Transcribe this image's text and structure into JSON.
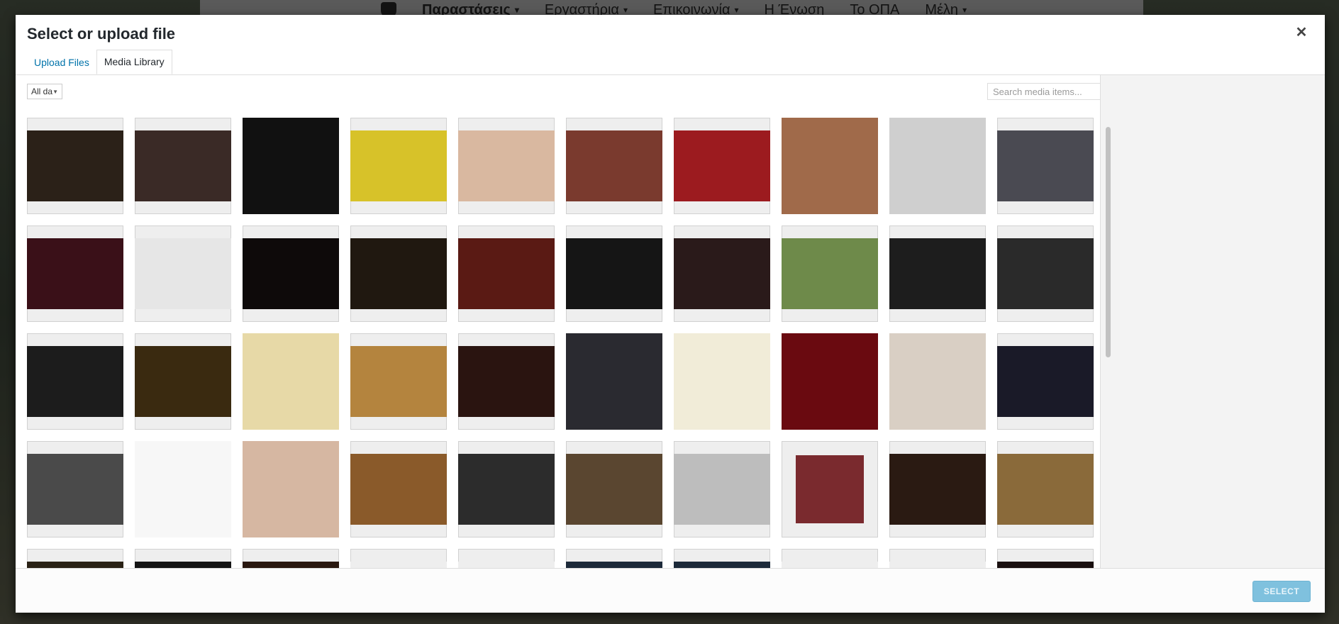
{
  "background_nav": {
    "items": [
      {
        "label": "Παραστάσεις",
        "caret": "▾"
      },
      {
        "label": "Εργαστήρια",
        "caret": "▾"
      },
      {
        "label": "Επικοινωνία",
        "caret": "▾"
      },
      {
        "label": "Η Ένωση",
        "caret": ""
      },
      {
        "label": "Το ΟΠΑ",
        "caret": ""
      },
      {
        "label": "Μέλη",
        "caret": "▾"
      }
    ]
  },
  "modal": {
    "title": "Select or upload file",
    "close_icon": "close-icon",
    "tabs": [
      {
        "label": "Upload Files",
        "active": false
      },
      {
        "label": "Media Library",
        "active": true
      }
    ],
    "filter": {
      "selected": "All da"
    },
    "search": {
      "placeholder": "Search media items..."
    },
    "select_button": "SELECT"
  },
  "media_items": [
    {
      "color": "#2b2118",
      "shape": "wide"
    },
    {
      "color": "#3a2a26",
      "shape": "wide"
    },
    {
      "color": "#111111",
      "shape": "tall"
    },
    {
      "color": "#d7c229",
      "shape": "wide"
    },
    {
      "color": "#d9b8a0",
      "shape": "wide"
    },
    {
      "color": "#7a3a2e",
      "shape": "wide"
    },
    {
      "color": "#9c1b1f",
      "shape": "wide"
    },
    {
      "color": "#a06a4a",
      "shape": "tall"
    },
    {
      "color": "#cfcfcf",
      "shape": "tall"
    },
    {
      "color": "#4a4a52",
      "shape": "wide"
    },
    {
      "color": "#3a1018",
      "shape": "wide"
    },
    {
      "color": "#e6e6e6",
      "shape": "wide"
    },
    {
      "color": "#0e0a0a",
      "shape": "wide"
    },
    {
      "color": "#201810",
      "shape": "wide"
    },
    {
      "color": "#5a1a14",
      "shape": "wide"
    },
    {
      "color": "#151515",
      "shape": "wide"
    },
    {
      "color": "#2a1a1a",
      "shape": "wide"
    },
    {
      "color": "#6e8a4a",
      "shape": "wide"
    },
    {
      "color": "#1d1d1d",
      "shape": "wide"
    },
    {
      "color": "#2a2a2a",
      "shape": "wide"
    },
    {
      "color": "#1c1c1c",
      "shape": "wide"
    },
    {
      "color": "#3a2a10",
      "shape": "wide"
    },
    {
      "color": "#e7d9a7",
      "shape": "tall"
    },
    {
      "color": "#b4843e",
      "shape": "wide"
    },
    {
      "color": "#2a1410",
      "shape": "wide"
    },
    {
      "color": "#2a2a30",
      "shape": "tall"
    },
    {
      "color": "#f1ecd8",
      "shape": "tall"
    },
    {
      "color": "#6a0a10",
      "shape": "tall"
    },
    {
      "color": "#d9cfc4",
      "shape": "tall"
    },
    {
      "color": "#1a1a28",
      "shape": "wide"
    },
    {
      "color": "#4a4a4a",
      "shape": "wide"
    },
    {
      "color": "#f7f7f7",
      "shape": "tall"
    },
    {
      "color": "#d6b7a2",
      "shape": "tall"
    },
    {
      "color": "#8a5a2a",
      "shape": "wide"
    },
    {
      "color": "#2c2c2c",
      "shape": "wide"
    },
    {
      "color": "#5a4630",
      "shape": "wide"
    },
    {
      "color": "#bdbdbd",
      "shape": "wide"
    },
    {
      "color": "#7a2a2e",
      "shape": "sq"
    },
    {
      "color": "#2a1a12",
      "shape": "wide"
    },
    {
      "color": "#8a6a3a",
      "shape": "wide"
    },
    {
      "color": "#2a2216",
      "shape": "wide"
    },
    {
      "color": "#151515",
      "shape": "wide"
    },
    {
      "color": "#2a1810",
      "shape": "wide"
    },
    {
      "color": "#eeeeee",
      "shape": "wide"
    },
    {
      "color": "#eeeeee",
      "shape": "wide"
    },
    {
      "color": "#1d2a3a",
      "shape": "wide"
    },
    {
      "color": "#1d2a3a",
      "shape": "wide"
    },
    {
      "color": "#eeeeee",
      "shape": "wide"
    },
    {
      "color": "#eeeeee",
      "shape": "wide"
    },
    {
      "color": "#1a1010",
      "shape": "wide"
    }
  ]
}
